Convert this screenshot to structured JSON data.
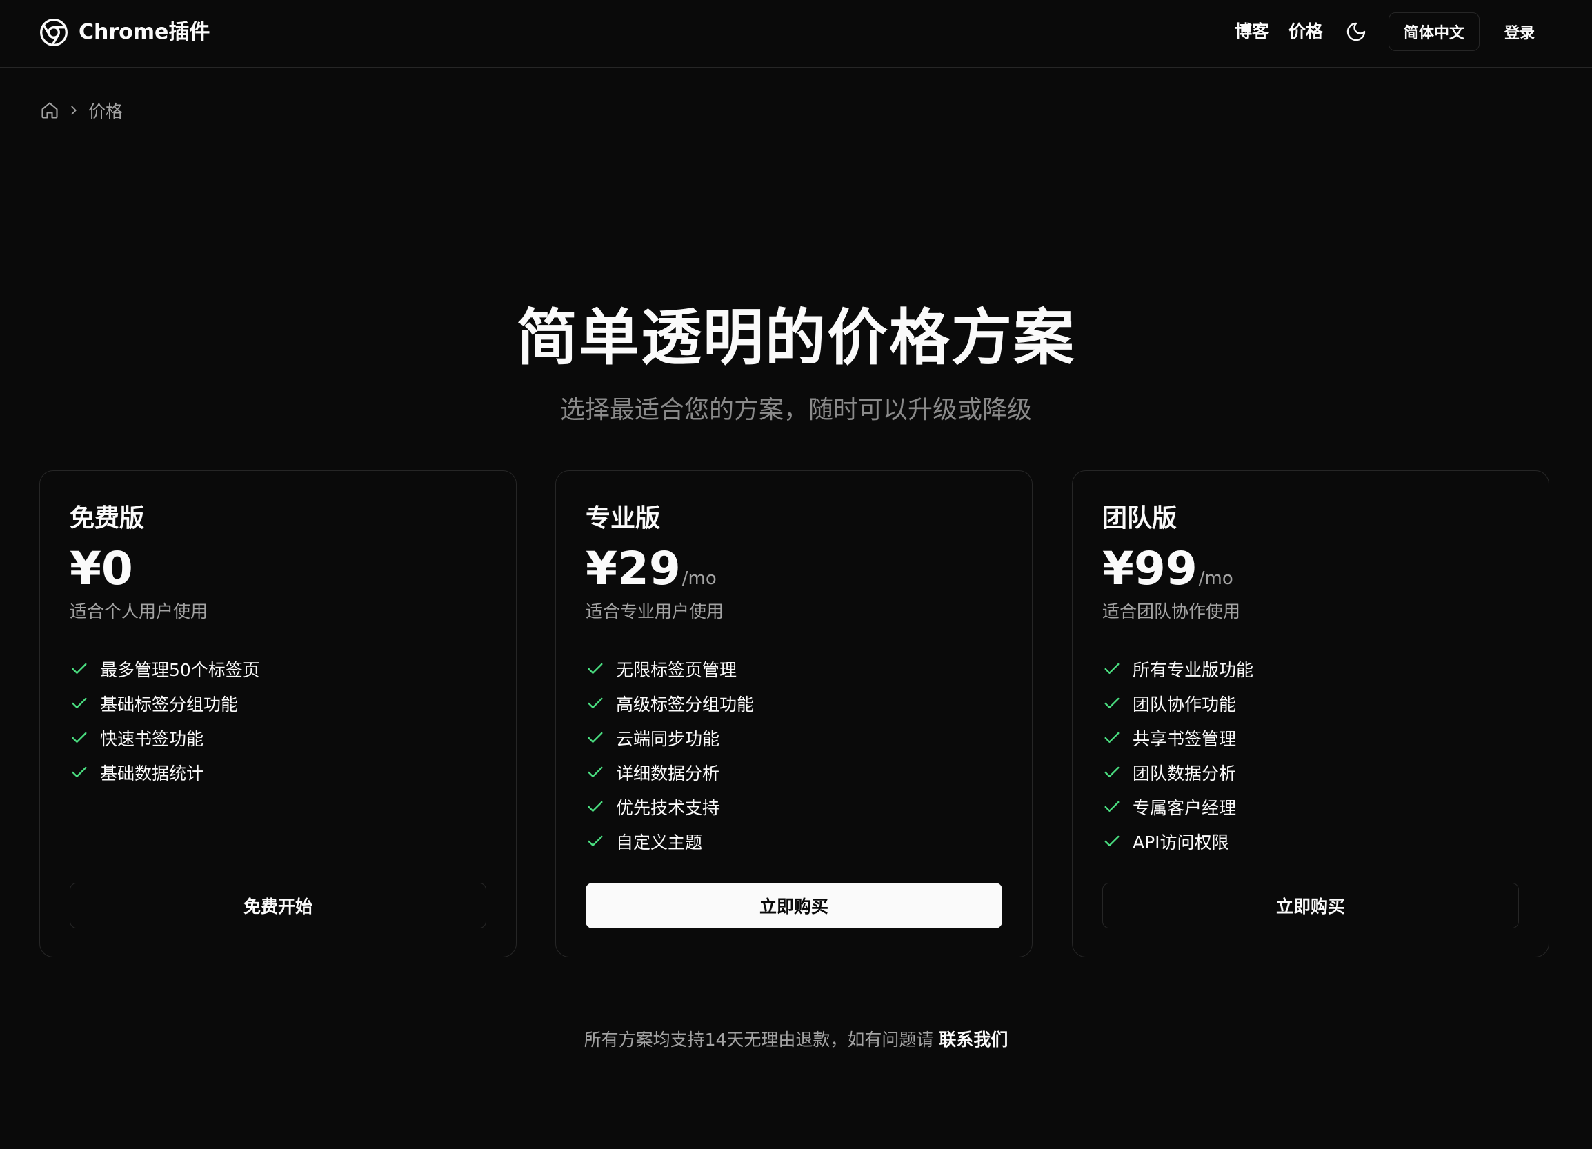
{
  "header": {
    "logo_text": "Chrome插件",
    "nav": {
      "blog": "博客",
      "pricing": "价格"
    },
    "language": "简体中文",
    "login": "登录"
  },
  "breadcrumb": {
    "current": "价格"
  },
  "hero": {
    "title": "简单透明的价格方案",
    "subtitle": "选择最适合您的方案，随时可以升级或降级"
  },
  "plans": [
    {
      "name": "免费版",
      "price": "¥0",
      "unit": "",
      "description": "适合个人用户使用",
      "features": [
        "最多管理50个标签页",
        "基础标签分组功能",
        "快速书签功能",
        "基础数据统计"
      ],
      "button": "免费开始"
    },
    {
      "name": "专业版",
      "price": "¥29",
      "unit": "/mo",
      "description": "适合专业用户使用",
      "features": [
        "无限标签页管理",
        "高级标签分组功能",
        "云端同步功能",
        "详细数据分析",
        "优先技术支持",
        "自定义主题"
      ],
      "button": "立即购买"
    },
    {
      "name": "团队版",
      "price": "¥99",
      "unit": "/mo",
      "description": "适合团队协作使用",
      "features": [
        "所有专业版功能",
        "团队协作功能",
        "共享书签管理",
        "团队数据分析",
        "专属客户经理",
        "API访问权限"
      ],
      "button": "立即购买"
    }
  ],
  "footer": {
    "note": "所有方案均支持14天无理由退款，如有问题请",
    "contact": "联系我们"
  },
  "colors": {
    "background": "#0a0a0a",
    "border": "#262626",
    "text": "#fafafa",
    "muted": "#a3a3a3",
    "check": "#4ade80"
  },
  "icons": [
    "chrome-logo-icon",
    "moon-icon",
    "home-icon",
    "chevron-right-icon",
    "check-icon"
  ]
}
